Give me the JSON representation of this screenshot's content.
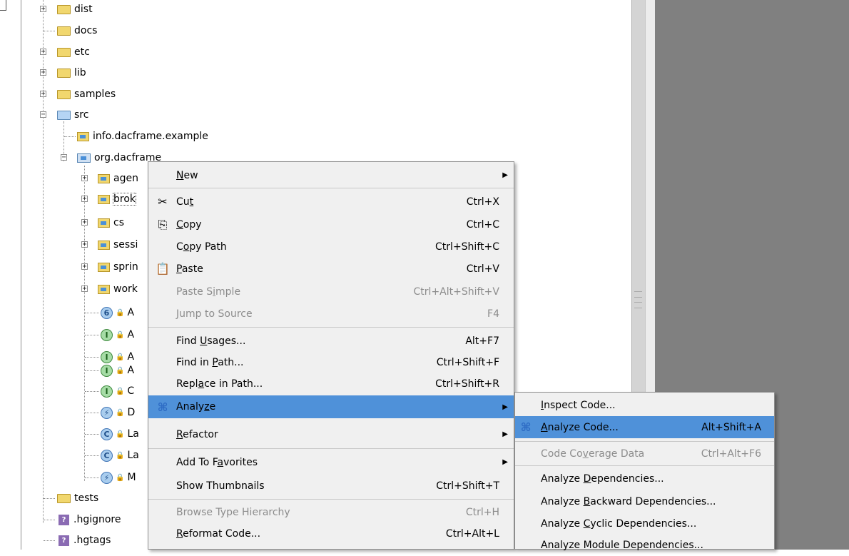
{
  "tree": {
    "top_items": [
      {
        "label": "dist"
      },
      {
        "label": "docs"
      },
      {
        "label": "etc"
      },
      {
        "label": "lib"
      },
      {
        "label": "samples"
      },
      {
        "label": "src"
      }
    ],
    "src_children": [
      {
        "label": "info.dacframe.example"
      },
      {
        "label": "org.dacframe"
      }
    ],
    "org_children": [
      {
        "label": "agen"
      },
      {
        "label": "brok"
      },
      {
        "label": "cs"
      },
      {
        "label": "sessi"
      },
      {
        "label": "sprin"
      },
      {
        "label": "work"
      }
    ],
    "org_files": [
      {
        "badge": "6",
        "label": "A",
        "lock": "🔒"
      },
      {
        "badge": "I",
        "label": "A",
        "lock": "🔒"
      },
      {
        "badge": "I",
        "label": "A",
        "lock": "🔒"
      },
      {
        "badge": "I",
        "label": "A",
        "lock": "🔒"
      },
      {
        "badge": "I",
        "label": "C",
        "lock": "🔒"
      },
      {
        "badge": "⚡",
        "label": "D",
        "lock": "🔒"
      },
      {
        "badge": "C",
        "label": "La",
        "lock": "🔒"
      },
      {
        "badge": "C",
        "label": "La",
        "lock": "🔒"
      },
      {
        "badge": "⚡",
        "label": "M",
        "lock": "🔒"
      }
    ],
    "bottom_items": [
      {
        "label": "tests"
      },
      {
        "label": ".hgignore",
        "badge": "?"
      },
      {
        "label": ".hgtags",
        "badge": "?"
      }
    ]
  },
  "context_menu": {
    "new": {
      "pre": "",
      "u": "N",
      "post": "ew"
    },
    "cut": {
      "pre": "Cu",
      "u": "t",
      "post": "",
      "shortcut": "Ctrl+X"
    },
    "copy": {
      "pre": "",
      "u": "C",
      "post": "opy",
      "shortcut": "Ctrl+C"
    },
    "copy_path": {
      "pre": "C",
      "u": "o",
      "post": "py Path",
      "shortcut": "Ctrl+Shift+C"
    },
    "paste": {
      "pre": "",
      "u": "P",
      "post": "aste",
      "shortcut": "Ctrl+V"
    },
    "paste_simple": {
      "pre": "Paste S",
      "u": "i",
      "post": "mple",
      "shortcut": "Ctrl+Alt+Shift+V"
    },
    "jump_to_source": {
      "pre": "",
      "u": "J",
      "post": "ump to Source",
      "shortcut": "F4"
    },
    "find_usages": {
      "pre": "Find ",
      "u": "U",
      "post": "sages...",
      "shortcut": "Alt+F7"
    },
    "find_in_path": {
      "pre": "Find in ",
      "u": "P",
      "post": "ath...",
      "shortcut": "Ctrl+Shift+F"
    },
    "replace_in_path": {
      "pre": "Repl",
      "u": "a",
      "post": "ce in Path...",
      "shortcut": "Ctrl+Shift+R"
    },
    "analyze": {
      "pre": "Analy",
      "u": "z",
      "post": "e"
    },
    "refactor": {
      "pre": "",
      "u": "R",
      "post": "efactor"
    },
    "add_to_favorites": {
      "pre": "Add To F",
      "u": "a",
      "post": "vorites"
    },
    "show_thumbnails": {
      "pre": "Show Thumbnails",
      "u": "",
      "post": "",
      "shortcut": "Ctrl+Shift+T"
    },
    "browse_type_hierarchy": {
      "pre": "Browse Type Hierarchy",
      "u": "",
      "post": "",
      "shortcut": "Ctrl+H"
    },
    "reformat_code": {
      "pre": "",
      "u": "R",
      "post": "eformat Code...",
      "shortcut": "Ctrl+Alt+L"
    }
  },
  "analyze_submenu": {
    "inspect_code": {
      "pre": "",
      "u": "I",
      "post": "nspect Code..."
    },
    "analyze_code": {
      "pre": "",
      "u": "A",
      "post": "nalyze Code...",
      "shortcut": "Alt+Shift+A"
    },
    "code_coverage": {
      "pre": "Code Co",
      "u": "v",
      "post": "erage Data",
      "shortcut": "Ctrl+Alt+F6"
    },
    "analyze_dependencies": {
      "pre": "Analyze ",
      "u": "D",
      "post": "ependencies..."
    },
    "analyze_backward": {
      "pre": "Analyze ",
      "u": "B",
      "post": "ackward Dependencies..."
    },
    "analyze_cyclic": {
      "pre": "Analyze ",
      "u": "C",
      "post": "yclic Dependencies..."
    },
    "analyze_module": {
      "pre": "Analyze Module Dependencies...",
      "u": "",
      "post": ""
    }
  },
  "icons": {
    "folder": "folder-icon",
    "package": "package-icon",
    "cut": "scissors-icon",
    "copy": "copy-icon",
    "paste": "paste-icon",
    "analyze": "analyze-icon",
    "submenu": "chevron-right-icon"
  }
}
